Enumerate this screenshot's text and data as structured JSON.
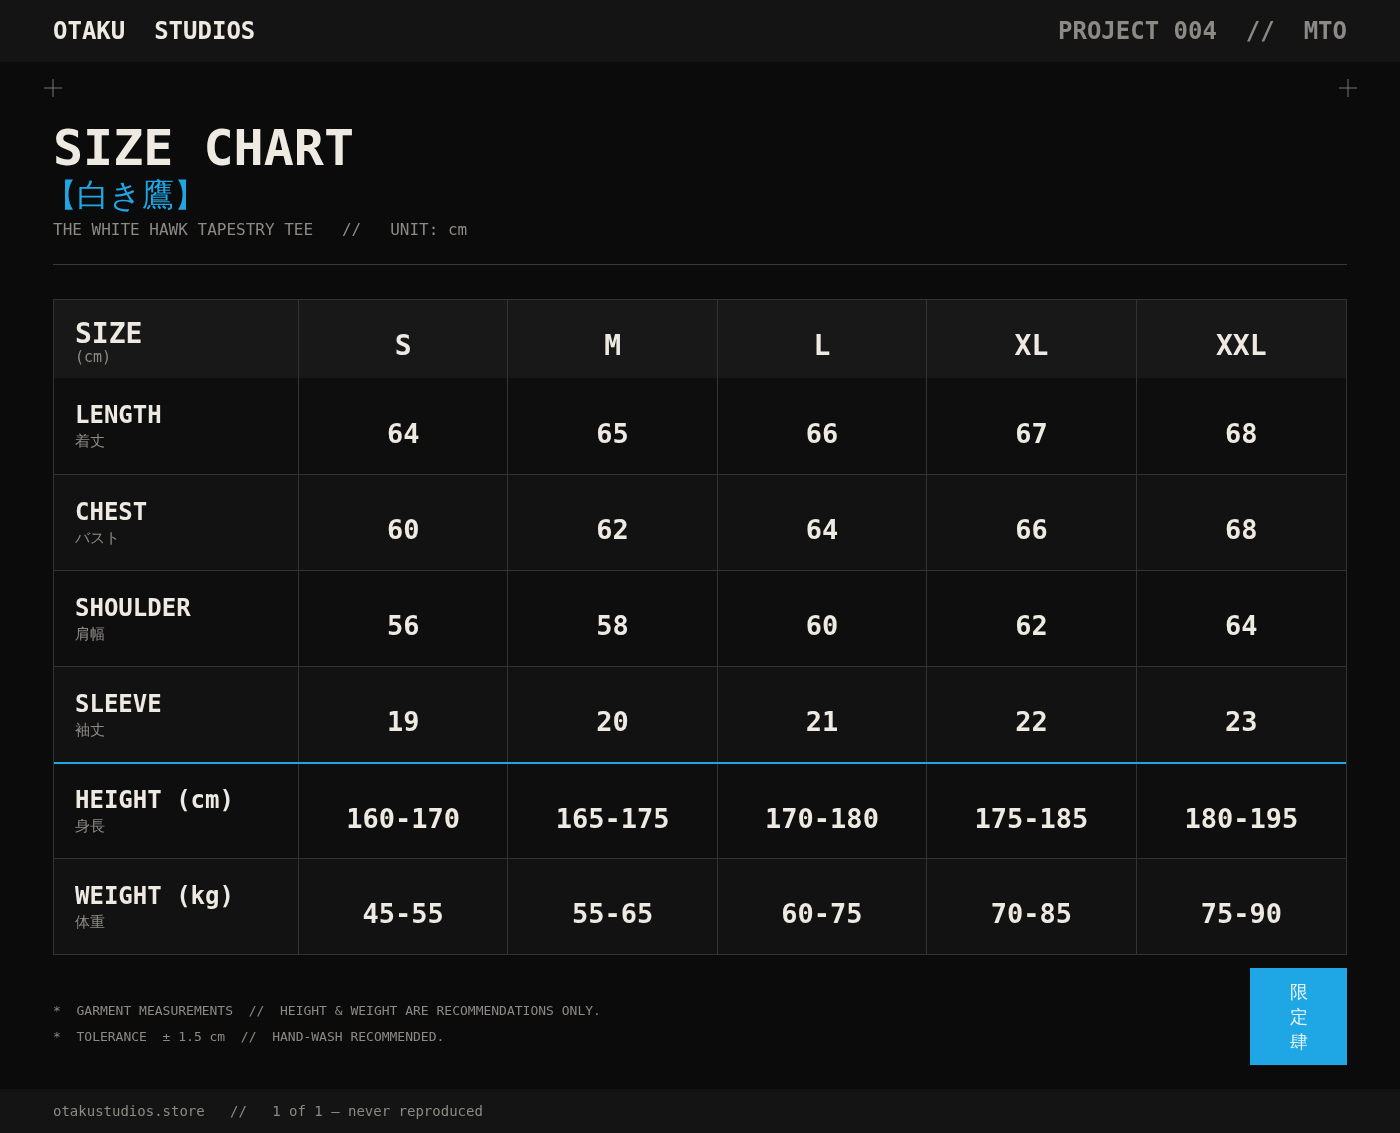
{
  "header": {
    "brand": "OTAKU  STUDIOS",
    "project": "PROJECT 004  //  MTO"
  },
  "title": "SIZE CHART",
  "title_jp": "【白き鷹】",
  "subtitle": "THE WHITE HAWK TAPESTRY TEE   //   UNIT: cm",
  "table": {
    "corner": {
      "label": "SIZE",
      "unit": "(cm)"
    },
    "columns": [
      "S",
      "M",
      "L",
      "XL",
      "XXL"
    ],
    "sections": [
      {
        "kind": "garment",
        "rows": [
          {
            "label": "LENGTH",
            "label_jp": "着丈",
            "values": [
              "64",
              "65",
              "66",
              "67",
              "68"
            ]
          },
          {
            "label": "CHEST",
            "label_jp": "バスト",
            "values": [
              "60",
              "62",
              "64",
              "66",
              "68"
            ]
          },
          {
            "label": "SHOULDER",
            "label_jp": "肩幅",
            "values": [
              "56",
              "58",
              "60",
              "62",
              "64"
            ]
          },
          {
            "label": "SLEEVE",
            "label_jp": "袖丈",
            "values": [
              "19",
              "20",
              "21",
              "22",
              "23"
            ]
          }
        ]
      },
      {
        "kind": "body",
        "rows": [
          {
            "label": "HEIGHT (cm)",
            "label_jp": "身長",
            "values": [
              "160-170",
              "165-175",
              "170-180",
              "175-185",
              "180-195"
            ]
          },
          {
            "label": "WEIGHT (kg)",
            "label_jp": "体重",
            "values": [
              "45-55",
              "55-65",
              "60-75",
              "70-85",
              "75-90"
            ]
          }
        ]
      }
    ]
  },
  "notes": [
    "*  GARMENT MEASUREMENTS  //  HEIGHT & WEIGHT ARE RECOMMENDATIONS ONLY.",
    "*  TOLERANCE  ± 1.5 cm  //  HAND-WASH RECOMMENDED."
  ],
  "stamp": "限定肆",
  "footer": "otakustudios.store   //   1 of 1 — never reproduced"
}
